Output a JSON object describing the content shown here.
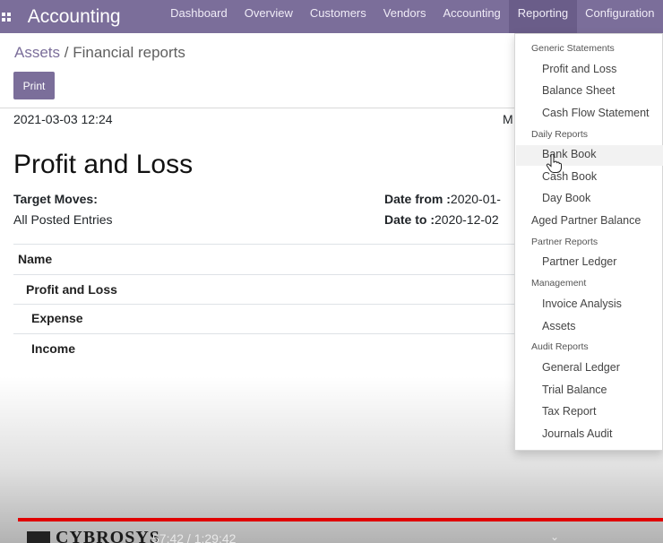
{
  "navbar": {
    "brand": "Accounting",
    "items": [
      "Dashboard",
      "Overview",
      "Customers",
      "Vendors",
      "Accounting",
      "Reporting",
      "Configuration"
    ],
    "active": "Reporting"
  },
  "breadcrumb": {
    "parent": "Assets",
    "separator": "/",
    "current": "Financial reports"
  },
  "control": {
    "print_label": "Print"
  },
  "report": {
    "datetime": "2021-03-03 12:24",
    "truncated_m": "M",
    "title": "Profit and Loss",
    "target_moves_label": "Target Moves:",
    "target_moves_value": "All Posted Entries",
    "date_from_label": "Date from :",
    "date_from_value": "2020-01-",
    "date_to_label": "Date to :",
    "date_to_value": "2020-12-02",
    "table": {
      "header": "Name",
      "rows": [
        "Profit and Loss",
        "Expense",
        "Income"
      ]
    }
  },
  "dropdown": {
    "generic_header": "Generic Statements",
    "profit_loss": "Profit and Loss",
    "balance_sheet": "Balance Sheet",
    "cash_flow": "Cash Flow Statement",
    "daily_header": "Daily Reports",
    "bank_book": "Bank Book",
    "cash_book": "Cash Book",
    "day_book": "Day Book",
    "aged_partner": "Aged Partner Balance",
    "partner_header": "Partner Reports",
    "partner_ledger": "Partner Ledger",
    "management_header": "Management",
    "invoice_analysis": "Invoice Analysis",
    "assets": "Assets",
    "audit_header": "Audit Reports",
    "general_ledger": "General Ledger",
    "trial_balance": "Trial Balance",
    "tax_report": "Tax Report",
    "journals_audit": "Journals Audit"
  },
  "video": {
    "logo_text": "CYBROSYS",
    "time": "57:42 / 1:29:42",
    "progress": 0.642
  },
  "colors": {
    "navbar": "#7b6e9a",
    "accent": "#7b6e9a",
    "progress": "#e00000"
  }
}
